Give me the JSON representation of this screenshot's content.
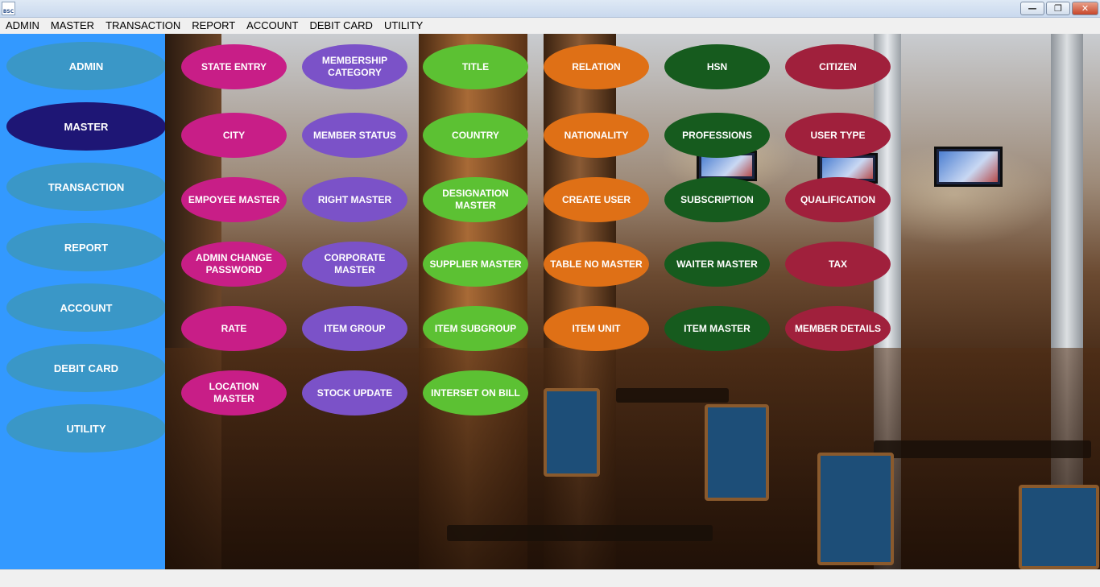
{
  "window": {
    "icon_text": "BSC",
    "minimize": "—",
    "maximize": "❐",
    "close": "✕"
  },
  "menu": [
    "ADMIN",
    "MASTER",
    "TRANSACTION",
    "REPORT",
    "ACCOUNT",
    "DEBIT CARD",
    "UTILITY"
  ],
  "sidebar": [
    {
      "label": "ADMIN",
      "active": false
    },
    {
      "label": "MASTER",
      "active": true
    },
    {
      "label": "TRANSACTION",
      "active": false
    },
    {
      "label": "REPORT",
      "active": false
    },
    {
      "label": "ACCOUNT",
      "active": false
    },
    {
      "label": "DEBIT CARD",
      "active": false
    },
    {
      "label": "UTILITY",
      "active": false
    }
  ],
  "colors": {
    "magenta": "#c81e87",
    "purple": "#7b52c8",
    "green": "#5cc133",
    "orange": "#df7016",
    "darkgreen": "#165b1e",
    "crimson": "#a0203c"
  },
  "grid": {
    "columns": [
      "magenta",
      "purple",
      "green",
      "orange",
      "darkgreen",
      "crimson"
    ],
    "rows": [
      [
        "STATE ENTRY",
        "MEMBERSHIP CATEGORY",
        "TITLE",
        "RELATION",
        "HSN",
        "CITIZEN"
      ],
      [
        "CITY",
        "MEMBER STATUS",
        "COUNTRY",
        "NATIONALITY",
        "PROFESSIONS",
        "USER TYPE"
      ],
      [
        "EMPOYEE MASTER",
        "RIGHT MASTER",
        "DESIGNATION MASTER",
        "CREATE USER",
        "SUBSCRIPTION",
        "QUALIFICATION"
      ],
      [
        "ADMIN CHANGE PASSWORD",
        "CORPORATE MASTER",
        "SUPPLIER MASTER",
        "TABLE NO MASTER",
        "WAITER MASTER",
        "TAX"
      ],
      [
        "RATE",
        "ITEM GROUP",
        "ITEM SUBGROUP",
        "ITEM UNIT",
        "ITEM MASTER",
        "MEMBER DETAILS"
      ],
      [
        "LOCATION MASTER",
        "STOCK UPDATE",
        "INTERSET ON BILL"
      ]
    ]
  }
}
